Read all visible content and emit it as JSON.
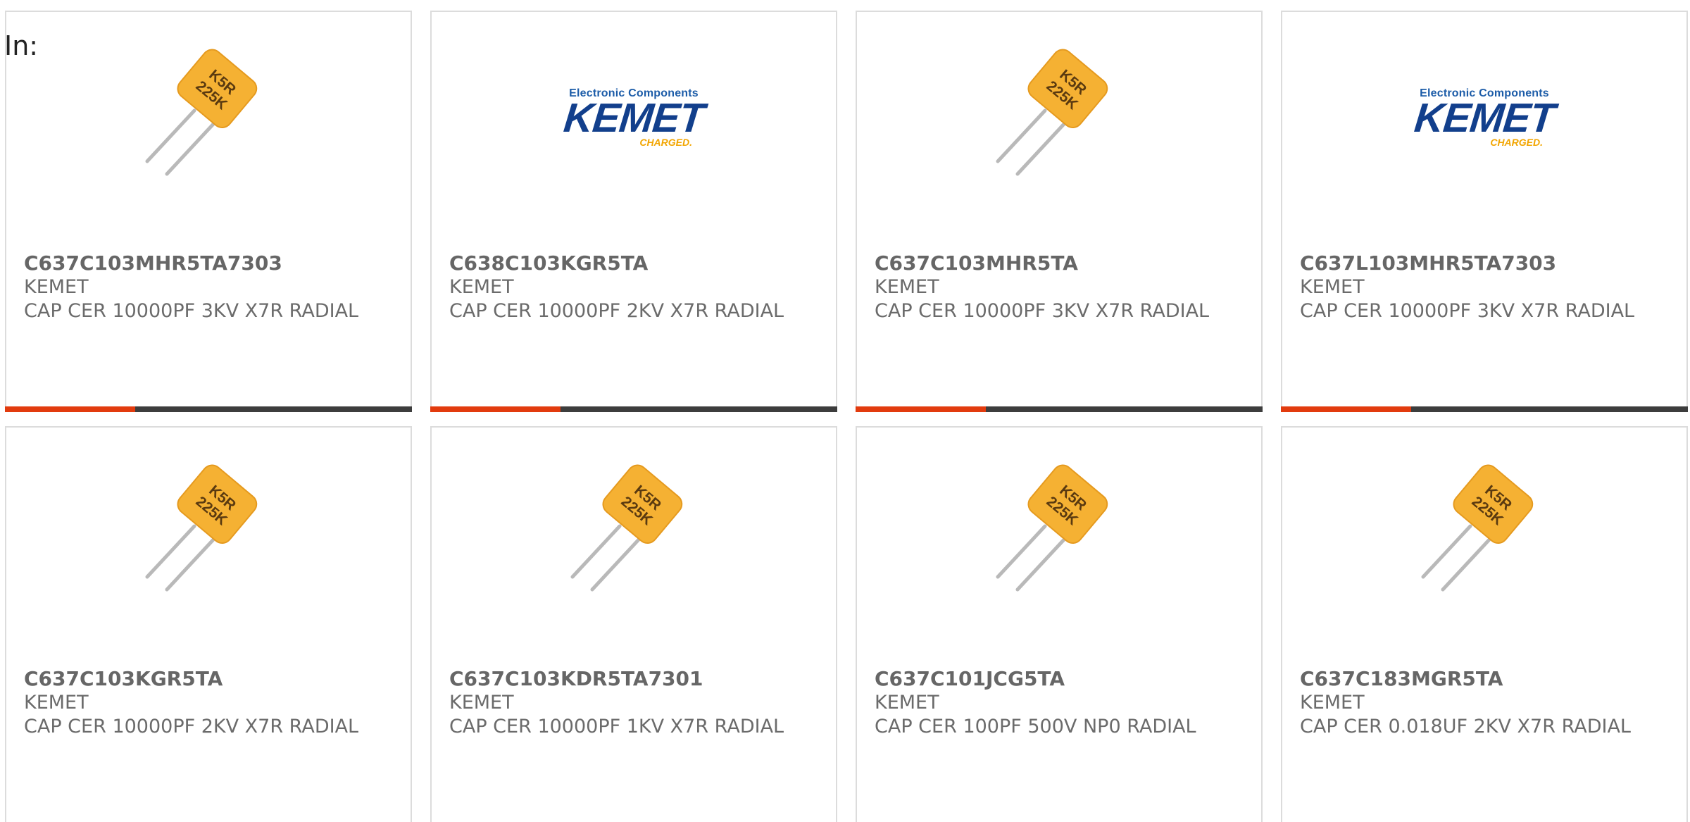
{
  "header": {
    "label": "In:"
  },
  "products": [
    {
      "part_number": "C637C103MHR5TA7303",
      "manufacturer": "KEMET",
      "description": "CAP CER 10000PF 3KV X7R RADIAL",
      "image": "capacitor",
      "cap_marking": [
        "K5R",
        "225K"
      ]
    },
    {
      "part_number": "C638C103KGR5TA",
      "manufacturer": "KEMET",
      "description": "CAP CER 10000PF 2KV X7R RADIAL",
      "image": "kemet-logo",
      "logo": {
        "tagline": "Electronic Components",
        "word": "KEMET",
        "charged": "CHARGED."
      }
    },
    {
      "part_number": "C637C103MHR5TA",
      "manufacturer": "KEMET",
      "description": "CAP CER 10000PF 3KV X7R RADIAL",
      "image": "capacitor",
      "cap_marking": [
        "K5R",
        "225K"
      ]
    },
    {
      "part_number": "C637L103MHR5TA7303",
      "manufacturer": "KEMET",
      "description": "CAP CER 10000PF 3KV X7R RADIAL",
      "image": "kemet-logo",
      "logo": {
        "tagline": "Electronic Components",
        "word": "KEMET",
        "charged": "CHARGED."
      }
    },
    {
      "part_number": "C637C103KGR5TA",
      "manufacturer": "KEMET",
      "description": "CAP CER 10000PF 2KV X7R RADIAL",
      "image": "capacitor",
      "cap_marking": [
        "K5R",
        "225K"
      ]
    },
    {
      "part_number": "C637C103KDR5TA7301",
      "manufacturer": "KEMET",
      "description": "CAP CER 10000PF 1KV X7R RADIAL",
      "image": "capacitor",
      "cap_marking": [
        "K5R",
        "225K"
      ]
    },
    {
      "part_number": "C637C101JCG5TA",
      "manufacturer": "KEMET",
      "description": "CAP CER 100PF 500V NP0 RADIAL",
      "image": "capacitor",
      "cap_marking": [
        "K5R",
        "225K"
      ]
    },
    {
      "part_number": "C637C183MGR5TA",
      "manufacturer": "KEMET",
      "description": "CAP CER 0.018UF 2KV X7R RADIAL",
      "image": "capacitor",
      "cap_marking": [
        "K5R",
        "225K"
      ]
    }
  ],
  "colors": {
    "accent_bar": "#e23b0e",
    "bar_base": "#3d3d3d",
    "capacitor_body": "#f5b133",
    "text_gray": "#6b6b6b",
    "kemet_blue": "#123f8c"
  }
}
